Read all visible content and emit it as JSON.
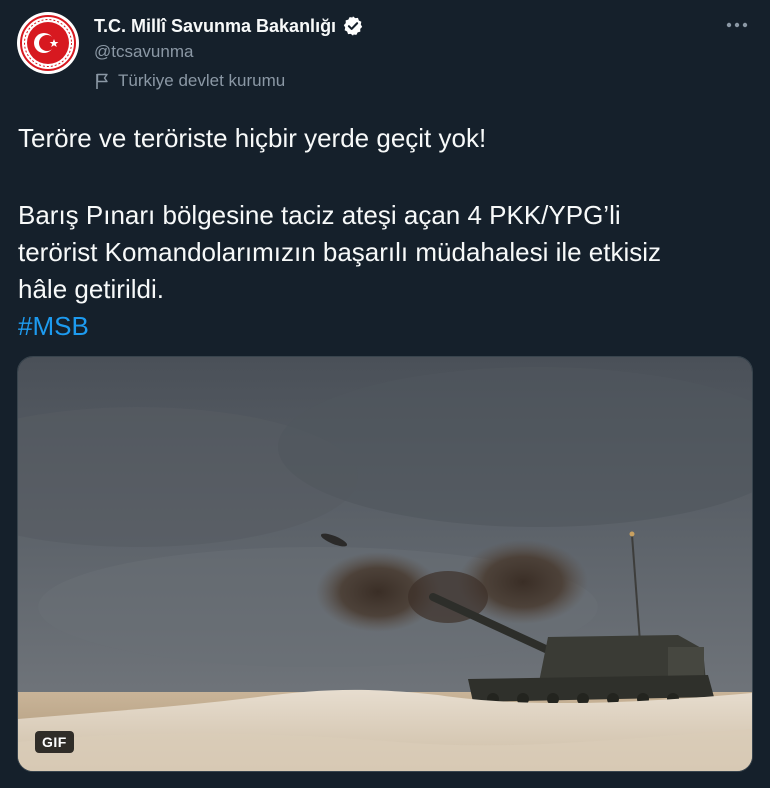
{
  "account": {
    "name": "T.C. Millî Savunma Bakanlığı",
    "handle": "@tcsavunma",
    "label": "Türkiye devlet kurumu"
  },
  "tweet": {
    "line1": "Teröre ve teröriste hiçbir yerde geçit yok!",
    "line2": "Barış Pınarı bölgesine taciz ateşi açan 4 PKK/YPG’li",
    "line3": "terörist Komandolarımızın başarılı müdahalesi ile etkisiz",
    "line4": "hâle getirildi.",
    "hashtag": "#MSB"
  },
  "media": {
    "badge": "GIF"
  },
  "icons": {
    "avatar": "ministry-emblem",
    "verified": "verified-badge-icon",
    "label": "flag-icon",
    "more": "more-icon"
  },
  "colors": {
    "background": "#15202b",
    "text": "#f7f9f9",
    "secondary": "#8b98a5",
    "link": "#1d9bf0",
    "emblem_red": "#d71920"
  }
}
